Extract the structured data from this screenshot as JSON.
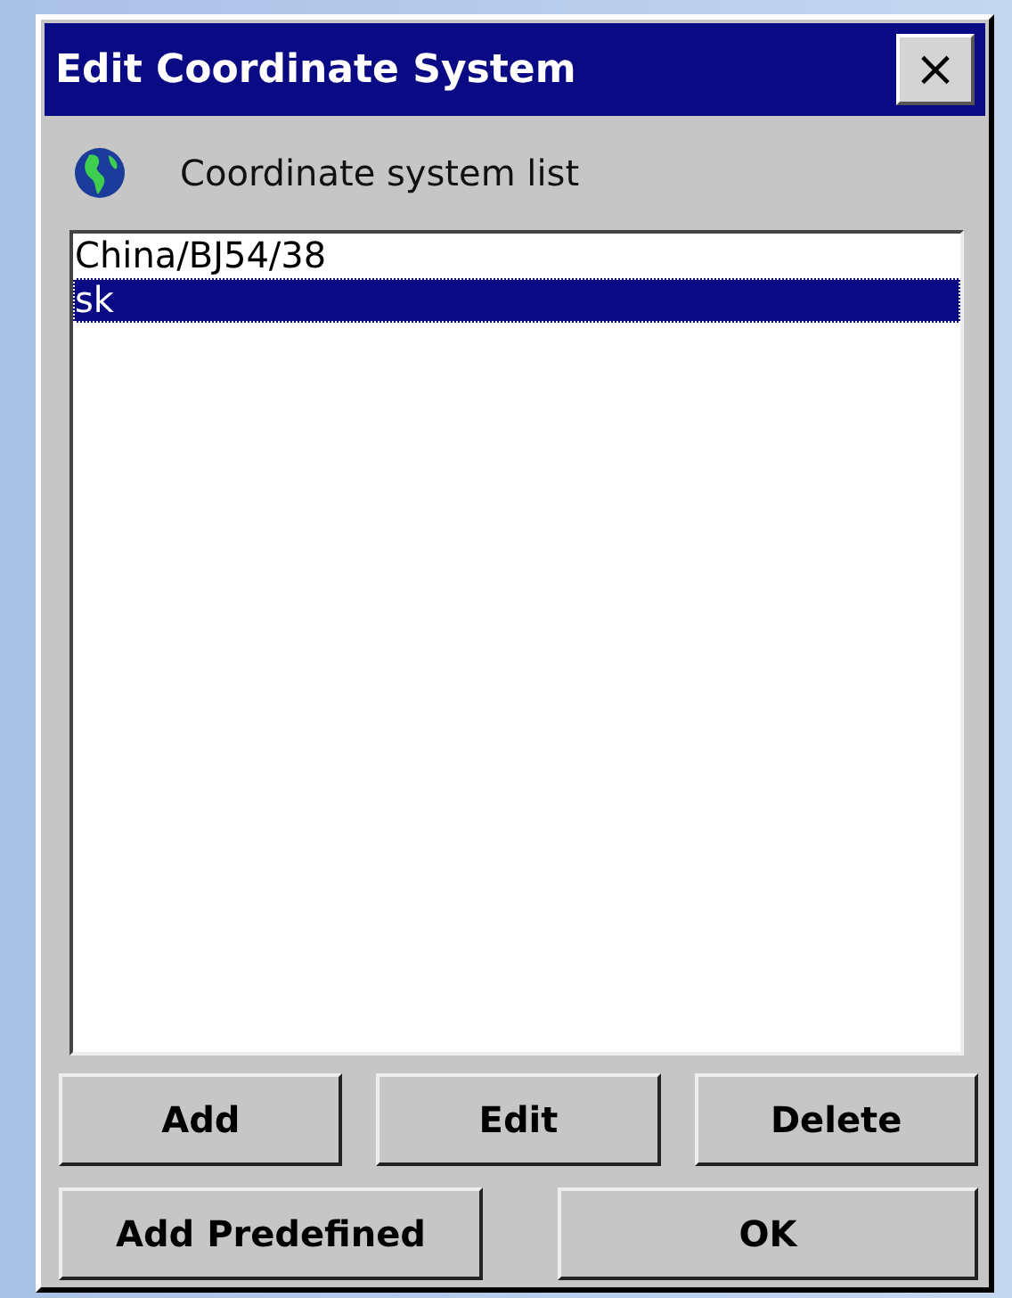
{
  "window": {
    "title": "Edit Coordinate System",
    "close": "×"
  },
  "header": {
    "label": "Coordinate system list"
  },
  "list": {
    "items": [
      {
        "label": "China/BJ54/38",
        "selected": false
      },
      {
        "label": "sk",
        "selected": true
      }
    ]
  },
  "buttons": [
    [
      "Add",
      "Edit",
      "Delete"
    ],
    [
      "Add Predefined",
      "OK"
    ]
  ]
}
